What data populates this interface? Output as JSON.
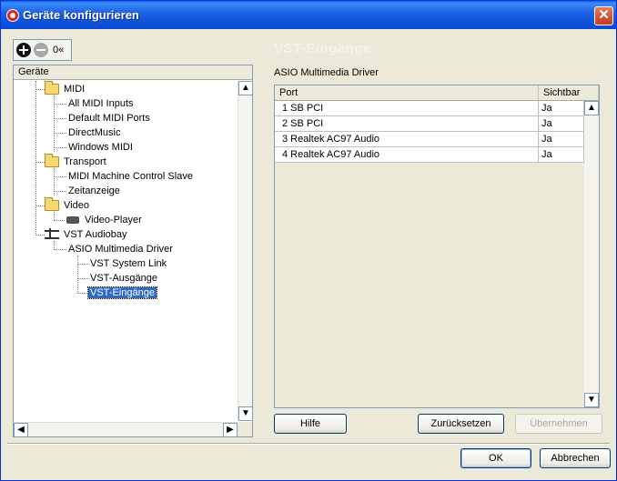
{
  "window": {
    "title": "Geräte konfigurieren",
    "close_symbol": "✕"
  },
  "toolbar": {
    "reset_label": "0«"
  },
  "section_title": "VST-Eingänge",
  "tree": {
    "header": "Geräte",
    "nodes": [
      {
        "label": "MIDI",
        "icon": "folder-icon"
      },
      {
        "label": "All MIDI Inputs"
      },
      {
        "label": "Default MIDI Ports"
      },
      {
        "label": "DirectMusic"
      },
      {
        "label": "Windows MIDI"
      },
      {
        "label": "Transport",
        "icon": "folder-icon"
      },
      {
        "label": "MIDI Machine Control Slave"
      },
      {
        "label": "Zeitanzeige"
      },
      {
        "label": "Video",
        "icon": "folder-icon"
      },
      {
        "label": "Video-Player",
        "icon": "video-icon"
      },
      {
        "label": "VST Audiobay",
        "icon": "audio-device-icon"
      },
      {
        "label": "ASIO Multimedia Driver"
      },
      {
        "label": "VST System Link"
      },
      {
        "label": "VST-Ausgänge"
      },
      {
        "label": "VST-Eingänge",
        "selected": true
      }
    ]
  },
  "right_panel": {
    "driver_label": "ASIO Multimedia Driver",
    "columns": [
      "Port",
      "Sichtbar"
    ],
    "rows": [
      {
        "port": "1 SB PCI",
        "visible": "Ja"
      },
      {
        "port": "2 SB PCI",
        "visible": "Ja"
      },
      {
        "port": "3 Realtek AC97 Audio",
        "visible": "Ja"
      },
      {
        "port": "4 Realtek AC97 Audio",
        "visible": "Ja"
      }
    ]
  },
  "buttons": {
    "help": "Hilfe",
    "reset": "Zurücksetzen",
    "apply": "Übernehmen",
    "ok": "OK",
    "cancel": "Abbrechen"
  },
  "scroll": {
    "up": "▲",
    "down": "▼",
    "left": "◀",
    "right": "▶"
  }
}
